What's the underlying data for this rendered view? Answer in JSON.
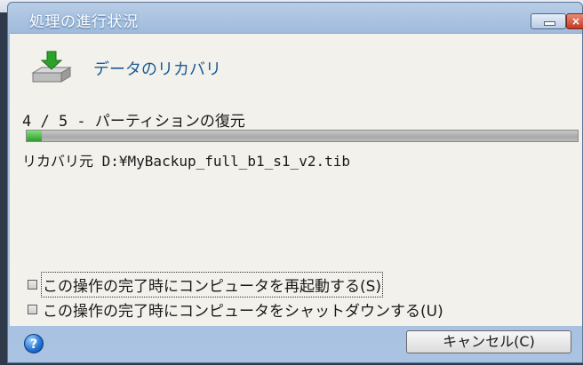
{
  "window": {
    "title": "処理の進行状況"
  },
  "task": {
    "title": "データのリカバリ",
    "step": "4 / 5 - パーティションの復元",
    "progress_fraction": 0.027,
    "source": "リカバリ元 D:¥MyBackup_full_b1_s1_v2.tib"
  },
  "options": [
    {
      "label": "この操作の完了時にコンピュータを再起動する(S)",
      "checked": false,
      "focused": true
    },
    {
      "label": "この操作の完了時にコンピュータをシャットダウンする(U)",
      "checked": false,
      "focused": false
    }
  ],
  "footer": {
    "cancel_label": "キャンセル(C)",
    "help_glyph": "?"
  },
  "icons": {
    "window_close": "×",
    "help": "help-icon",
    "task": "disk-restore-icon"
  },
  "colors": {
    "progress": "#3fb23a",
    "title_accent": "#1c5a96"
  }
}
